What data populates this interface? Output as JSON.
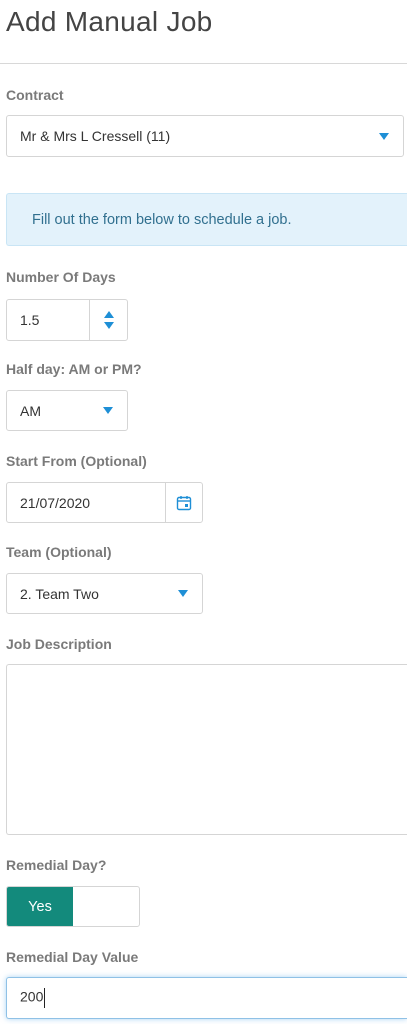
{
  "page": {
    "title": "Add Manual Job"
  },
  "contract": {
    "label": "Contract",
    "value": "Mr & Mrs L Cressell (11)"
  },
  "info_banner": {
    "text": "Fill out the form below to schedule a job."
  },
  "number_of_days": {
    "label": "Number Of Days",
    "value": "1.5"
  },
  "half_day": {
    "label": "Half day: AM or PM?",
    "value": "AM"
  },
  "start_from": {
    "label": "Start From (Optional)",
    "value": "21/07/2020"
  },
  "team": {
    "label": "Team (Optional)",
    "value": "2. Team Two"
  },
  "job_description": {
    "label": "Job Description",
    "value": ""
  },
  "remedial_day": {
    "label": "Remedial Day?",
    "toggle_label": "Yes",
    "on": true
  },
  "remedial_day_value": {
    "label": "Remedial Day Value",
    "value": "200"
  },
  "colors": {
    "accent": "#1e8fd6",
    "toggle_on": "#138a7c",
    "info_bg": "#e3f2fb",
    "info_text": "#31708f"
  },
  "icons": [
    "caret-down-icon",
    "spinner-up-icon",
    "spinner-down-icon",
    "calendar-icon"
  ]
}
